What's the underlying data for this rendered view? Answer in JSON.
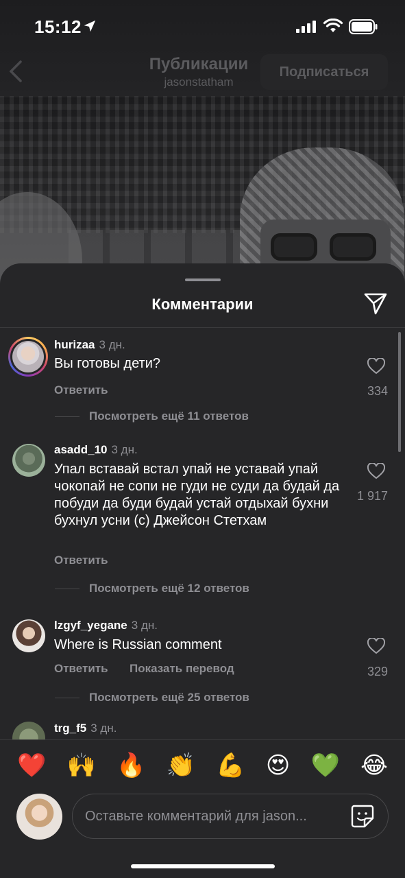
{
  "status_bar": {
    "time": "15:12"
  },
  "top_nav": {
    "title": "Публикации",
    "subtitle": "jasonstatham",
    "follow_label": "Подписаться"
  },
  "sheet": {
    "title": "Комментарии"
  },
  "comments": [
    {
      "username": "hurizaa",
      "ago": "3 дн.",
      "text": "Вы готовы дети?",
      "reply_label": "Ответить",
      "likes": "334",
      "more_replies": "Посмотреть ещё 11 ответов"
    },
    {
      "username": "asadd_10",
      "ago": "3 дн.",
      "text": "Упал вставай встал упай не уставай упай чокопай не сопи не гуди не суди да будай да побуди да буди будай устай отдыхай бухни бухнул усни (с) Джейсон Стетхам",
      "reply_label": "Ответить",
      "likes": "1 917",
      "more_replies": "Посмотреть ещё 12 ответов"
    },
    {
      "username": "lzgyf_yegane",
      "ago": "3 дн.",
      "text": "Where is Russian comment",
      "reply_label": "Ответить",
      "translate_label": "Показать перевод",
      "likes": "329",
      "more_replies": "Посмотреть ещё 25 ответов"
    },
    {
      "username": "trg_f5",
      "ago": "3 дн."
    }
  ],
  "emoji_bar": [
    "❤️",
    "🙌",
    "🔥",
    "👏",
    "💪",
    "😍",
    "💚",
    "😂"
  ],
  "composer": {
    "placeholder": "Оставьте комментарий для jason..."
  },
  "colors": {
    "sheet_bg": "#262628",
    "secondary_text": "#8e8e93",
    "divider": "#3a3a3c"
  }
}
